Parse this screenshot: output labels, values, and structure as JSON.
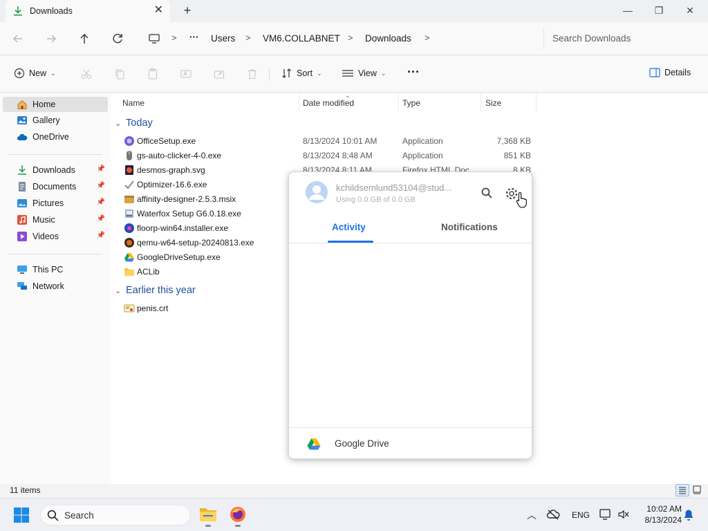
{
  "tab": {
    "title": "Downloads",
    "close": "✕",
    "new_tab": "+"
  },
  "window": {
    "minimize": "—",
    "maximize": "❐",
    "close": "✕"
  },
  "address": {
    "more": "···",
    "crumbs": [
      "Users",
      "VM6.COLLABNET",
      "Downloads"
    ],
    "separator": ">"
  },
  "search": {
    "placeholder": "Search Downloads"
  },
  "commands": {
    "new": "New",
    "sort": "Sort",
    "view": "View",
    "more": "···",
    "details": "Details"
  },
  "sidebar": {
    "items": [
      {
        "label": "Home",
        "icon": "home-icon"
      },
      {
        "label": "Gallery",
        "icon": "gallery-icon"
      },
      {
        "label": "OneDrive",
        "icon": "cloud-icon"
      },
      {
        "label": "Downloads",
        "icon": "download-icon",
        "pinned": true
      },
      {
        "label": "Documents",
        "icon": "documents-icon",
        "pinned": true
      },
      {
        "label": "Pictures",
        "icon": "pictures-icon",
        "pinned": true
      },
      {
        "label": "Music",
        "icon": "music-icon",
        "pinned": true
      },
      {
        "label": "Videos",
        "icon": "videos-icon",
        "pinned": true
      },
      {
        "label": "This PC",
        "icon": "pc-icon"
      },
      {
        "label": "Network",
        "icon": "network-icon"
      }
    ]
  },
  "columns": {
    "name": "Name",
    "date": "Date modified",
    "type": "Type",
    "size": "Size"
  },
  "groups": {
    "today": "Today",
    "earlier": "Earlier this year"
  },
  "files_today": [
    {
      "name": "OfficeSetup.exe",
      "date": "8/13/2024 10:01 AM",
      "type": "Application",
      "size": "7,368 KB",
      "icon": "office-icon"
    },
    {
      "name": "gs-auto-clicker-4-0.exe",
      "date": "8/13/2024 8:48 AM",
      "type": "Application",
      "size": "851 KB",
      "icon": "mouse-icon"
    },
    {
      "name": "desmos-graph.svg",
      "date": "8/13/2024 8:11 AM",
      "type": "Firefox HTML Doc...",
      "size": "8 KB",
      "icon": "svg-file-icon"
    },
    {
      "name": "Optimizer-16.6.exe",
      "icon": "check-icon"
    },
    {
      "name": "affinity-designer-2.5.3.msix",
      "icon": "package-icon"
    },
    {
      "name": "Waterfox Setup G6.0.18.exe",
      "icon": "installer-icon"
    },
    {
      "name": "floorp-win64.installer.exe",
      "icon": "floorp-icon"
    },
    {
      "name": "qemu-w64-setup-20240813.exe",
      "icon": "qemu-icon"
    },
    {
      "name": "GoogleDriveSetup.exe",
      "icon": "google-drive-icon"
    },
    {
      "name": "ACLib",
      "icon": "folder-icon"
    }
  ],
  "files_earlier": [
    {
      "name": "penis.crt",
      "icon": "certificate-icon"
    }
  ],
  "drive_popup": {
    "account": "kchildsemlund53104@stud...",
    "usage": "Using 0.0 GB of 0.0 GB",
    "tab_activity": "Activity",
    "tab_notifications": "Notifications",
    "footer": "Google Drive"
  },
  "status": {
    "count": "11 items"
  },
  "taskbar": {
    "search": "Search",
    "lang": "ENG",
    "time": "10:02 AM",
    "date": "8/13/2024"
  },
  "colors": {
    "accent": "#1a73e8",
    "group_text": "#1e4f9c",
    "folder": "#f4c542"
  }
}
